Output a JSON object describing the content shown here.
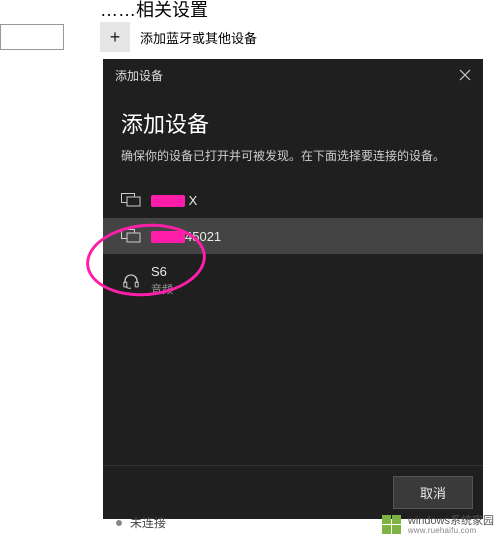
{
  "background": {
    "partial_heading": "……相关设置",
    "add_button_label": "添加蓝牙或其他设备",
    "bottom_status": "未连接"
  },
  "dialog": {
    "header_title": "添加设备",
    "title": "添加设备",
    "subtitle": "确保你的设备已打开并可被发现。在下面选择要连接的设备。",
    "devices": [
      {
        "name_suffix": " X",
        "kind": "display",
        "redacted": true,
        "highlighted": false
      },
      {
        "name_suffix": "45021",
        "kind": "display",
        "redacted": true,
        "highlighted": true
      },
      {
        "name": "S6",
        "kind": "headphones",
        "subtitle": "音频",
        "highlighted": false
      }
    ],
    "cancel_label": "取消"
  },
  "watermark": {
    "line1": "windows系统家园",
    "line2": "www.ruehaifu.com"
  },
  "icons": {
    "close": "close-icon",
    "plus": "plus-icon",
    "display": "display-icon",
    "headphones": "headphones-icon"
  }
}
